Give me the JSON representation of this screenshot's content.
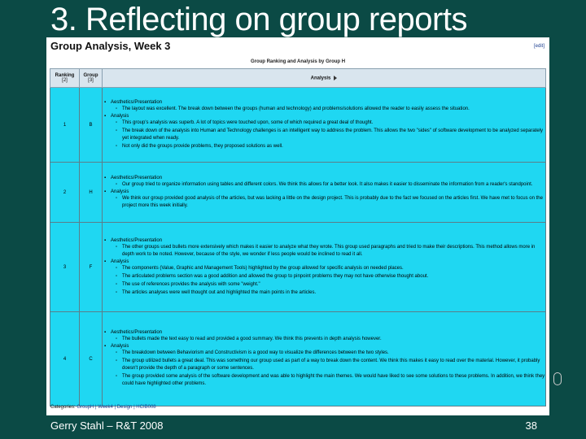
{
  "slide": {
    "title": "3. Reflecting on group reports",
    "footer_left": "Gerry Stahl – R&T 2008",
    "page_number": "38"
  },
  "screenshot": {
    "page_title": "Group Analysis, Week 3",
    "edit_link": "[edit]",
    "table_caption": "Group Ranking and Analysis by Group H",
    "columns": {
      "ranking": "Ranking",
      "ranking_sub": "[2]",
      "group": "Group",
      "group_sub": "[3]",
      "analysis": "Analysis"
    },
    "rows": [
      {
        "rank": "1",
        "group": "B",
        "sections": [
          {
            "heading": "Aesthetics/Presentation",
            "items": [
              "The layout was excellent. The break down between the groups (human and technology) and problems/solutions allowed the reader to easily assess the situation."
            ]
          },
          {
            "heading": "Analysis",
            "items": [
              "This group's analysis was superb. A lot of topics were touched upon, some of which required a great deal of thought.",
              "The break down of the analysis into Human and Technology challenges is an intelligent way to address the problem. This allows the two \"sides\" of software development to be analyzed separately yet integrated when ready.",
              "Not only did the groups provide problems, they proposed solutions as well."
            ]
          }
        ]
      },
      {
        "rank": "2",
        "group": "H",
        "sections": [
          {
            "heading": "Aesthetics/Presentation",
            "items": [
              "Our group tried to organize information using tables and different colors. We think this allows for a better look. It also makes it easier to disseminate the information from a reader's standpoint."
            ]
          },
          {
            "heading": "Analysis",
            "items": [
              "We think our group provided good analysis of the articles, but was lacking a little on the design project. This is probably due to the fact we focused on the articles first. We have met to focus on the project more this week initially."
            ]
          }
        ]
      },
      {
        "rank": "3",
        "group": "F",
        "sections": [
          {
            "heading": "Aesthetics/Presentation",
            "items": [
              "The other groups used bullets more extensively which makes it easier to analyze what they wrote. This group used paragraphs and tried to make their descriptions. This method allows more in depth work to be noted. However, because of the style, we wonder if less people would be inclined to read it all."
            ]
          },
          {
            "heading": "Analysis",
            "items": [
              "The components (Value, Graphic and Management Tools) highlighted by the group allowed for specific analysis on needed places.",
              "The articulated problems section was a good addition and allowed the group to pinpoint problems they may not have otherwise thought about.",
              "The use of references provides the analysis with some \"weight.\"",
              "The articles analyses were well thought out and highlighted the main points in the articles."
            ]
          }
        ]
      },
      {
        "rank": "4",
        "group": "C",
        "sections": [
          {
            "heading": "Aesthetics/Presentation",
            "items": [
              "The bullets made the text easy to read and provided a good summary. We think this prevents in depth analysis however."
            ]
          },
          {
            "heading": "Analysis",
            "items": [
              "The breakdown between Behaviorism and Constructivism is a good way to visualize the differences between the two styles.",
              "The group utilized bullets a great deal. This was something our group used as part of a way to break down the content. We think this makes it easy to read over the material. However, it probably doesn't provide the depth of a paragraph or some sentences.",
              "The group provided some analysis of the software development and was able to highlight the main themes. We would have liked to see some solutions to these problems. In addition, we think they could have highlighted other problems."
            ]
          }
        ]
      }
    ],
    "categories_label": "Categories:",
    "categories_links": "GroupH | Week4 | Design | HCIB008"
  }
}
